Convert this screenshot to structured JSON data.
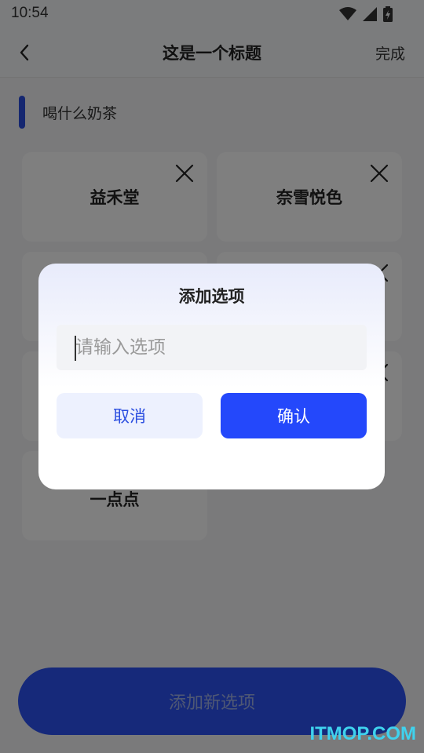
{
  "status_bar": {
    "time": "10:54"
  },
  "nav": {
    "title": "这是一个标题",
    "done_label": "完成"
  },
  "section": {
    "title": "喝什么奶茶"
  },
  "options": [
    {
      "label": "益禾堂"
    },
    {
      "label": "奈雪悦色"
    },
    {
      "label": ""
    },
    {
      "label": ""
    },
    {
      "label": ""
    },
    {
      "label": ""
    },
    {
      "label": "一点点"
    }
  ],
  "bottom": {
    "add_label": "添加新选项"
  },
  "dialog": {
    "title": "添加选项",
    "input_placeholder": "请输入选项",
    "input_value": "",
    "cancel_label": "取消",
    "confirm_label": "确认"
  },
  "watermark": "ITMOP.COM",
  "colors": {
    "accent": "#2448fb",
    "accent_light": "#edf1fe",
    "watermark": "#3fd2ee"
  },
  "icons": {
    "back": "chevron-left-icon",
    "delete": "close-icon",
    "wifi": "wifi-icon",
    "signal": "signal-icon",
    "battery": "battery-icon"
  }
}
